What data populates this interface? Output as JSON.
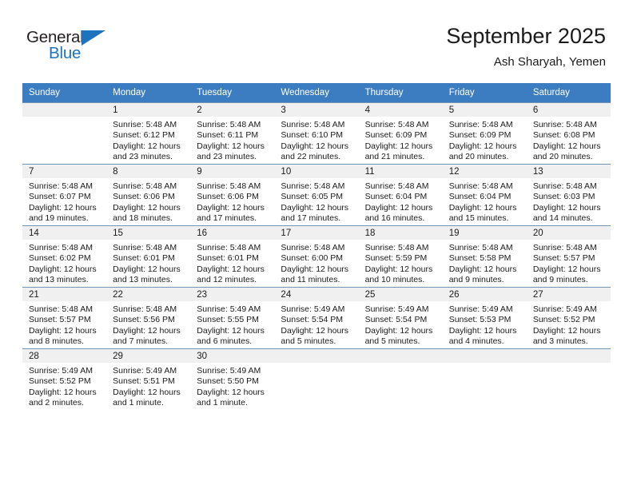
{
  "brand": {
    "name_top": "General",
    "name_bottom": "Blue",
    "triangle_color": "#1e73be",
    "top_color": "#231f20"
  },
  "header": {
    "title": "September 2025",
    "subtitle": "Ash Sharyah, Yemen"
  },
  "theme": {
    "header_bg": "#3c7cc0",
    "header_text": "#ffffff",
    "daynum_band_bg": "#f0f0f0",
    "row_border": "#7295b8",
    "body_text": "#1a1a1a"
  },
  "weekdays": [
    "Sunday",
    "Monday",
    "Tuesday",
    "Wednesday",
    "Thursday",
    "Friday",
    "Saturday"
  ],
  "labels": {
    "sunrise": "Sunrise:",
    "sunset": "Sunset:",
    "daylight": "Daylight:"
  },
  "weeks": [
    [
      {
        "day": "",
        "sunrise": "",
        "sunset": "",
        "daylight": ""
      },
      {
        "day": "1",
        "sunrise": "Sunrise: 5:48 AM",
        "sunset": "Sunset: 6:12 PM",
        "daylight": "Daylight: 12 hours and 23 minutes."
      },
      {
        "day": "2",
        "sunrise": "Sunrise: 5:48 AM",
        "sunset": "Sunset: 6:11 PM",
        "daylight": "Daylight: 12 hours and 23 minutes."
      },
      {
        "day": "3",
        "sunrise": "Sunrise: 5:48 AM",
        "sunset": "Sunset: 6:10 PM",
        "daylight": "Daylight: 12 hours and 22 minutes."
      },
      {
        "day": "4",
        "sunrise": "Sunrise: 5:48 AM",
        "sunset": "Sunset: 6:09 PM",
        "daylight": "Daylight: 12 hours and 21 minutes."
      },
      {
        "day": "5",
        "sunrise": "Sunrise: 5:48 AM",
        "sunset": "Sunset: 6:09 PM",
        "daylight": "Daylight: 12 hours and 20 minutes."
      },
      {
        "day": "6",
        "sunrise": "Sunrise: 5:48 AM",
        "sunset": "Sunset: 6:08 PM",
        "daylight": "Daylight: 12 hours and 20 minutes."
      }
    ],
    [
      {
        "day": "7",
        "sunrise": "Sunrise: 5:48 AM",
        "sunset": "Sunset: 6:07 PM",
        "daylight": "Daylight: 12 hours and 19 minutes."
      },
      {
        "day": "8",
        "sunrise": "Sunrise: 5:48 AM",
        "sunset": "Sunset: 6:06 PM",
        "daylight": "Daylight: 12 hours and 18 minutes."
      },
      {
        "day": "9",
        "sunrise": "Sunrise: 5:48 AM",
        "sunset": "Sunset: 6:06 PM",
        "daylight": "Daylight: 12 hours and 17 minutes."
      },
      {
        "day": "10",
        "sunrise": "Sunrise: 5:48 AM",
        "sunset": "Sunset: 6:05 PM",
        "daylight": "Daylight: 12 hours and 17 minutes."
      },
      {
        "day": "11",
        "sunrise": "Sunrise: 5:48 AM",
        "sunset": "Sunset: 6:04 PM",
        "daylight": "Daylight: 12 hours and 16 minutes."
      },
      {
        "day": "12",
        "sunrise": "Sunrise: 5:48 AM",
        "sunset": "Sunset: 6:04 PM",
        "daylight": "Daylight: 12 hours and 15 minutes."
      },
      {
        "day": "13",
        "sunrise": "Sunrise: 5:48 AM",
        "sunset": "Sunset: 6:03 PM",
        "daylight": "Daylight: 12 hours and 14 minutes."
      }
    ],
    [
      {
        "day": "14",
        "sunrise": "Sunrise: 5:48 AM",
        "sunset": "Sunset: 6:02 PM",
        "daylight": "Daylight: 12 hours and 13 minutes."
      },
      {
        "day": "15",
        "sunrise": "Sunrise: 5:48 AM",
        "sunset": "Sunset: 6:01 PM",
        "daylight": "Daylight: 12 hours and 13 minutes."
      },
      {
        "day": "16",
        "sunrise": "Sunrise: 5:48 AM",
        "sunset": "Sunset: 6:01 PM",
        "daylight": "Daylight: 12 hours and 12 minutes."
      },
      {
        "day": "17",
        "sunrise": "Sunrise: 5:48 AM",
        "sunset": "Sunset: 6:00 PM",
        "daylight": "Daylight: 12 hours and 11 minutes."
      },
      {
        "day": "18",
        "sunrise": "Sunrise: 5:48 AM",
        "sunset": "Sunset: 5:59 PM",
        "daylight": "Daylight: 12 hours and 10 minutes."
      },
      {
        "day": "19",
        "sunrise": "Sunrise: 5:48 AM",
        "sunset": "Sunset: 5:58 PM",
        "daylight": "Daylight: 12 hours and 9 minutes."
      },
      {
        "day": "20",
        "sunrise": "Sunrise: 5:48 AM",
        "sunset": "Sunset: 5:57 PM",
        "daylight": "Daylight: 12 hours and 9 minutes."
      }
    ],
    [
      {
        "day": "21",
        "sunrise": "Sunrise: 5:48 AM",
        "sunset": "Sunset: 5:57 PM",
        "daylight": "Daylight: 12 hours and 8 minutes."
      },
      {
        "day": "22",
        "sunrise": "Sunrise: 5:48 AM",
        "sunset": "Sunset: 5:56 PM",
        "daylight": "Daylight: 12 hours and 7 minutes."
      },
      {
        "day": "23",
        "sunrise": "Sunrise: 5:49 AM",
        "sunset": "Sunset: 5:55 PM",
        "daylight": "Daylight: 12 hours and 6 minutes."
      },
      {
        "day": "24",
        "sunrise": "Sunrise: 5:49 AM",
        "sunset": "Sunset: 5:54 PM",
        "daylight": "Daylight: 12 hours and 5 minutes."
      },
      {
        "day": "25",
        "sunrise": "Sunrise: 5:49 AM",
        "sunset": "Sunset: 5:54 PM",
        "daylight": "Daylight: 12 hours and 5 minutes."
      },
      {
        "day": "26",
        "sunrise": "Sunrise: 5:49 AM",
        "sunset": "Sunset: 5:53 PM",
        "daylight": "Daylight: 12 hours and 4 minutes."
      },
      {
        "day": "27",
        "sunrise": "Sunrise: 5:49 AM",
        "sunset": "Sunset: 5:52 PM",
        "daylight": "Daylight: 12 hours and 3 minutes."
      }
    ],
    [
      {
        "day": "28",
        "sunrise": "Sunrise: 5:49 AM",
        "sunset": "Sunset: 5:52 PM",
        "daylight": "Daylight: 12 hours and 2 minutes."
      },
      {
        "day": "29",
        "sunrise": "Sunrise: 5:49 AM",
        "sunset": "Sunset: 5:51 PM",
        "daylight": "Daylight: 12 hours and 1 minute."
      },
      {
        "day": "30",
        "sunrise": "Sunrise: 5:49 AM",
        "sunset": "Sunset: 5:50 PM",
        "daylight": "Daylight: 12 hours and 1 minute."
      },
      {
        "day": "",
        "sunrise": "",
        "sunset": "",
        "daylight": ""
      },
      {
        "day": "",
        "sunrise": "",
        "sunset": "",
        "daylight": ""
      },
      {
        "day": "",
        "sunrise": "",
        "sunset": "",
        "daylight": ""
      },
      {
        "day": "",
        "sunrise": "",
        "sunset": "",
        "daylight": ""
      }
    ]
  ]
}
